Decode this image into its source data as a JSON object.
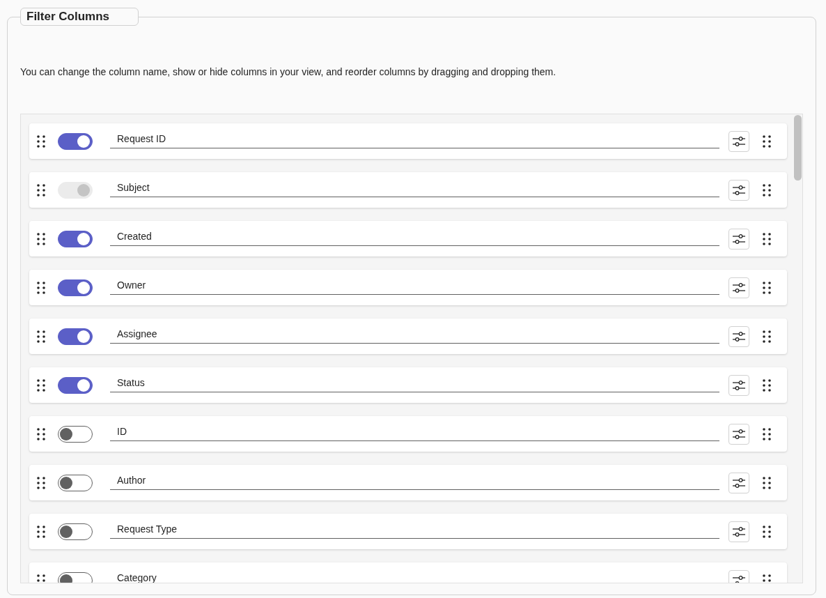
{
  "panel": {
    "title": "Filter Columns",
    "description": "You can change the column name, show or hide columns in your view, and reorder columns by dragging and dropping them."
  },
  "columns": [
    {
      "name": "Request ID",
      "visible": true,
      "disabled": false
    },
    {
      "name": "Subject",
      "visible": true,
      "disabled": true
    },
    {
      "name": "Created",
      "visible": true,
      "disabled": false
    },
    {
      "name": "Owner",
      "visible": true,
      "disabled": false
    },
    {
      "name": "Assignee",
      "visible": true,
      "disabled": false
    },
    {
      "name": "Status",
      "visible": true,
      "disabled": false
    },
    {
      "name": "ID",
      "visible": false,
      "disabled": false
    },
    {
      "name": "Author",
      "visible": false,
      "disabled": false
    },
    {
      "name": "Request Type",
      "visible": false,
      "disabled": false
    },
    {
      "name": "Category",
      "visible": false,
      "disabled": false
    }
  ]
}
